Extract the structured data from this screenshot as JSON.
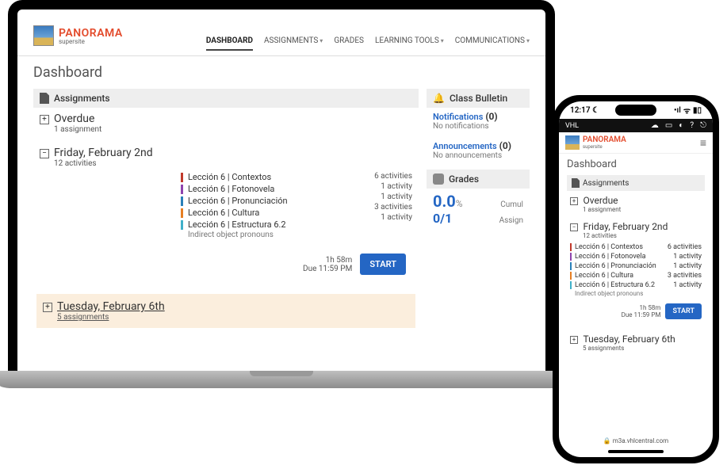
{
  "brand": {
    "name": "PANORAMA",
    "subtitle": "supersite"
  },
  "nav": {
    "dashboard": "DASHBOARD",
    "assignments": "ASSIGNMENTS",
    "grades": "GRADES",
    "learning_tools": "LEARNING TOOLS",
    "communications": "COMMUNICATIONS"
  },
  "page_title": "Dashboard",
  "assignments_header": "Assignments",
  "groups": {
    "overdue": {
      "title": "Overdue",
      "sub": "1 assignment",
      "expand": "+"
    },
    "friday": {
      "title": "Friday, February 2nd",
      "sub": "12 activities",
      "expand": "−",
      "lessons": [
        {
          "label": "Lección 6 | Contextos",
          "count": "6 activities"
        },
        {
          "label": "Lección 6 | Fotonovela",
          "count": "1 activity"
        },
        {
          "label": "Lección 6 | Pronunciación",
          "count": "1 activity"
        },
        {
          "label": "Lección 6 | Cultura",
          "count": "3 activities"
        },
        {
          "label": "Lección 6 | Estructura 6.2",
          "count": "1 activity"
        }
      ],
      "lesson_sub": "Indirect object pronouns",
      "time": "1h 58m",
      "due": "Due 11:59 PM",
      "start": "START"
    },
    "tuesday": {
      "title": "Tuesday, February 6th",
      "sub": "5 assignments",
      "expand": "+"
    }
  },
  "bulletin": {
    "header": "Class Bulletin",
    "notifications_label": "Notifications",
    "notifications_count": "(0)",
    "notifications_sub": "No notifications",
    "announcements_label": "Announcements",
    "announcements_count": "(0)",
    "announcements_sub": "No announcements"
  },
  "grades": {
    "header": "Grades",
    "score": "0.0",
    "pct": "%",
    "cumul": "Cumul",
    "ratio": "0/1",
    "assign": "Assign"
  },
  "mobile": {
    "status_time": "12:17",
    "app_label": "VHL",
    "url": "m3a.vhlcentral.com"
  }
}
